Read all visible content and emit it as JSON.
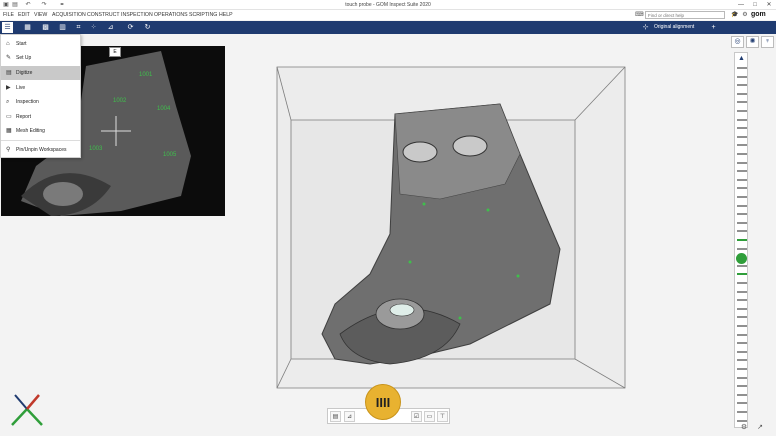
{
  "window": {
    "title": "touch probe - GOM Inspect Suite 2020",
    "quick_access": [
      "save-icon",
      "new-icon",
      "undo-icon",
      "redo-icon",
      "link-icon"
    ],
    "controls": [
      "minimize-icon",
      "maximize-icon",
      "close-icon"
    ]
  },
  "menu": {
    "items": [
      "FILE",
      "EDIT",
      "VIEW",
      "ACQUISITION",
      "CONSTRUCT",
      "INSPECTION",
      "OPERATIONS",
      "SCRIPTING",
      "HELP"
    ]
  },
  "search": {
    "placeholder": "Find or direct help"
  },
  "brand": {
    "logo": "gom"
  },
  "toolbar": {
    "alignment_label": "Original alignment",
    "accent": "#1f3b70"
  },
  "workspace_menu": {
    "items": [
      {
        "label": "Start",
        "icon": "home-icon"
      },
      {
        "label": "Set Up",
        "icon": "wrench-icon"
      },
      {
        "label": "Digitize",
        "icon": "scan-icon",
        "active": true
      },
      {
        "label": "Live",
        "icon": "camera-icon"
      },
      {
        "label": "Inspection",
        "icon": "magnifier-icon"
      },
      {
        "label": "Report",
        "icon": "report-icon"
      },
      {
        "label": "Mesh Editing",
        "icon": "mesh-icon"
      },
      {
        "label": "Pin/Unpin Workspaces",
        "icon": "pin-icon"
      }
    ]
  },
  "camera_view": {
    "badge": "E",
    "points": [
      "1001",
      "1002",
      "1003",
      "1004",
      "1005"
    ]
  },
  "capture": {
    "button_glyph": "IIII",
    "color": "#e8b230"
  },
  "status_colors": {
    "ok": "#2f9e3a"
  }
}
